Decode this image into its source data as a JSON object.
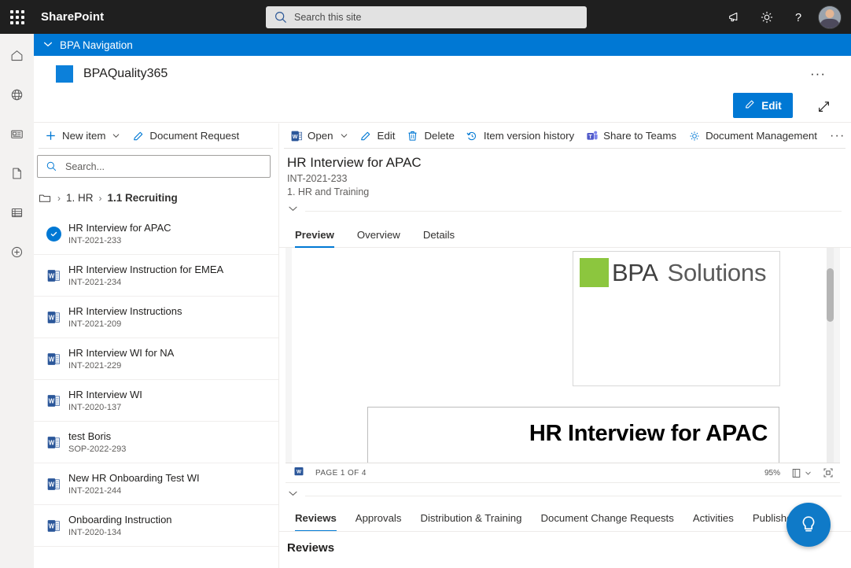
{
  "suite": {
    "waffle_label": "app-launcher",
    "brand": "SharePoint",
    "search_placeholder": "Search this site",
    "actions": [
      {
        "name": "megaphone-icon",
        "label": "What's new"
      },
      {
        "name": "gear-icon",
        "label": "Settings"
      },
      {
        "name": "question-icon",
        "label": "Help"
      }
    ],
    "avatar_label": "User account"
  },
  "rail": {
    "items": [
      {
        "name": "home-icon",
        "label": "Home"
      },
      {
        "name": "globe-icon",
        "label": "Sites"
      },
      {
        "name": "news-icon",
        "label": "News"
      },
      {
        "name": "page-icon",
        "label": "Pages"
      },
      {
        "name": "list-icon",
        "label": "Lists"
      },
      {
        "name": "plus-circle-icon",
        "label": "Create"
      }
    ]
  },
  "nav_banner": {
    "label": "BPA Navigation"
  },
  "site": {
    "title": "BPAQuality365",
    "logo_color": "#0c80da",
    "ellipsis": "···"
  },
  "edit_row": {
    "edit_label": "Edit",
    "expand_label": "Full screen"
  },
  "left_commandbar": {
    "items": [
      {
        "name": "new-item-command",
        "icon": "plus-icon",
        "label": "New item",
        "caret": true
      },
      {
        "name": "document-request-command",
        "icon": "pencil-icon",
        "label": "Document Request",
        "caret": false
      }
    ]
  },
  "right_commandbar": {
    "items": [
      {
        "name": "open-command",
        "icon": "word-icon",
        "label": "Open",
        "caret": true
      },
      {
        "name": "edit-command",
        "icon": "pencil-icon",
        "label": "Edit",
        "caret": false
      },
      {
        "name": "delete-command",
        "icon": "trash-icon",
        "label": "Delete",
        "caret": false
      },
      {
        "name": "item-version-history-command",
        "icon": "history-icon",
        "label": "Item version history",
        "caret": false
      },
      {
        "name": "share-to-teams-command",
        "icon": "teams-icon",
        "label": "Share to Teams",
        "caret": false
      },
      {
        "name": "document-management-command",
        "icon": "gear-icon",
        "label": "Document Management",
        "caret": false
      }
    ],
    "more": "···"
  },
  "list_pane": {
    "search_placeholder": "Search...",
    "breadcrumb": {
      "folder_icon": "folder-icon",
      "separator": "›",
      "items": [
        {
          "label": "1. HR",
          "current": false
        },
        {
          "label": "1.1 Recruiting",
          "current": true
        }
      ]
    },
    "documents": [
      {
        "title": "HR Interview for APAC",
        "code": "INT-2021-233",
        "icon": "selected-check-icon",
        "selected": true
      },
      {
        "title": "HR Interview Instruction for EMEA",
        "code": "INT-2021-234",
        "icon": "word-icon",
        "selected": false
      },
      {
        "title": "HR Interview Instructions",
        "code": "INT-2021-209",
        "icon": "word-icon",
        "selected": false
      },
      {
        "title": "HR Interview WI for NA",
        "code": "INT-2021-229",
        "icon": "word-icon",
        "selected": false
      },
      {
        "title": "HR Interview WI",
        "code": "INT-2020-137",
        "icon": "word-icon",
        "selected": false
      },
      {
        "title": "test Boris",
        "code": "SOP-2022-293",
        "icon": "word-icon",
        "selected": false
      },
      {
        "title": "New HR Onboarding Test WI",
        "code": "INT-2021-244",
        "icon": "word-icon",
        "selected": false
      },
      {
        "title": "Onboarding Instruction",
        "code": "INT-2020-134",
        "icon": "word-icon",
        "selected": false
      }
    ]
  },
  "detail": {
    "title": "HR Interview for APAC",
    "code": "INT-2021-233",
    "category": "1. HR and Training",
    "collapse_icon": "chevron-down-icon",
    "tabs": [
      {
        "label": "Preview",
        "active": true
      },
      {
        "label": "Overview",
        "active": false
      },
      {
        "label": "Details",
        "active": false
      }
    ]
  },
  "preview": {
    "logo": {
      "square_color": "#8cc63e",
      "word1": "BPA",
      "word2": "Solutions"
    },
    "doc_title": "HR Interview for APAC",
    "footer": {
      "app_icon": "word-icon",
      "page_status": "PAGE 1 OF 4",
      "zoom": "95%",
      "layout_icon": "page-layout-icon",
      "layout_caret": "chevron-down-icon",
      "fit_icon": "fit-page-icon"
    }
  },
  "bottom": {
    "collapse_icon": "chevron-down-icon",
    "tabs": [
      {
        "label": "Reviews",
        "active": true
      },
      {
        "label": "Approvals",
        "active": false
      },
      {
        "label": "Distribution & Training",
        "active": false
      },
      {
        "label": "Document Change Requests",
        "active": false
      },
      {
        "label": "Activities",
        "active": false
      },
      {
        "label": "Published Docu",
        "active": false
      }
    ],
    "section_heading": "Reviews"
  },
  "fab": {
    "name": "lightbulb-icon",
    "label": "Help and feedback",
    "color": "#0f7ac8"
  }
}
